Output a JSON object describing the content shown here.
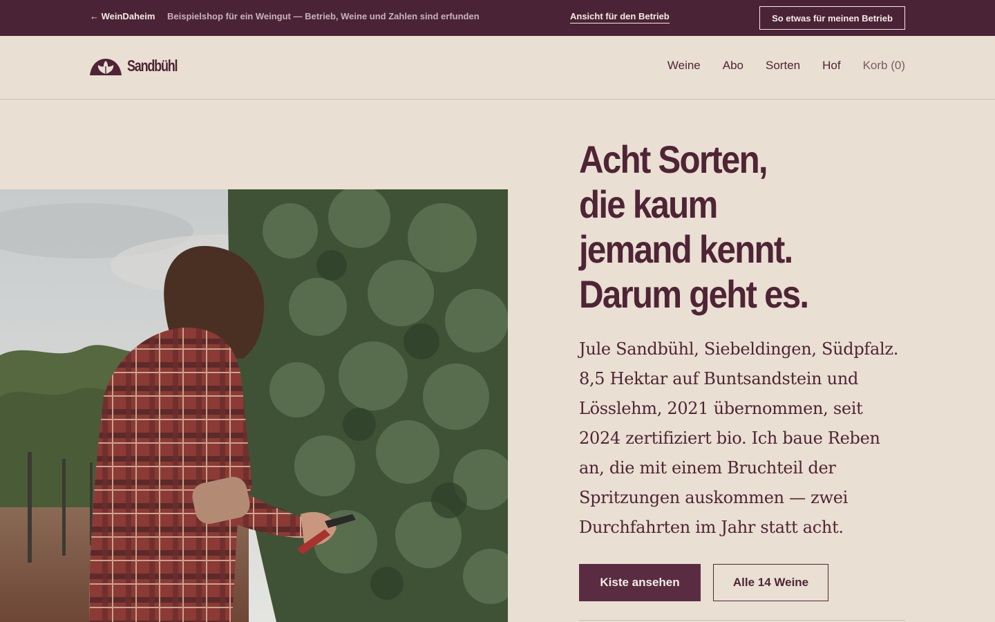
{
  "topbar": {
    "back_link": "← WeinDaheim",
    "note": "Beispielshop für ein Weingut — Betrieb, Weine und Zahlen sind erfunden",
    "owner_link": "Ansicht für den Betrieb",
    "cta": "So etwas für meinen Betrieb"
  },
  "header": {
    "logo_text": "Sandbühl",
    "nav": [
      {
        "label": "Weine"
      },
      {
        "label": "Abo"
      },
      {
        "label": "Sorten"
      },
      {
        "label": "Hof"
      },
      {
        "label": "Korb (0)"
      }
    ]
  },
  "hero": {
    "headline_lines": [
      "Acht Sorten,",
      "die kaum",
      "jemand kennt.",
      "Darum geht es."
    ],
    "lede": "Jule Sandbühl, Siebeldingen, Südpfalz. 8,5 Hektar auf Buntsandstein und Lösslehm, 2021 übernommen, seit 2024 zertifiziert bio. Ich baue Reben an, die mit einem Bruchteil der Spritzungen auskommen — zwei Durchfahrten im Jahr statt acht.",
    "primary_button": "Kiste ansehen",
    "secondary_button": "Alle 14 Weine"
  },
  "colors": {
    "topbar_bg": "#4b2336",
    "page_bg": "#e9dfd2",
    "brand": "#4f2436",
    "primary_button_bg": "#5a2c42"
  }
}
